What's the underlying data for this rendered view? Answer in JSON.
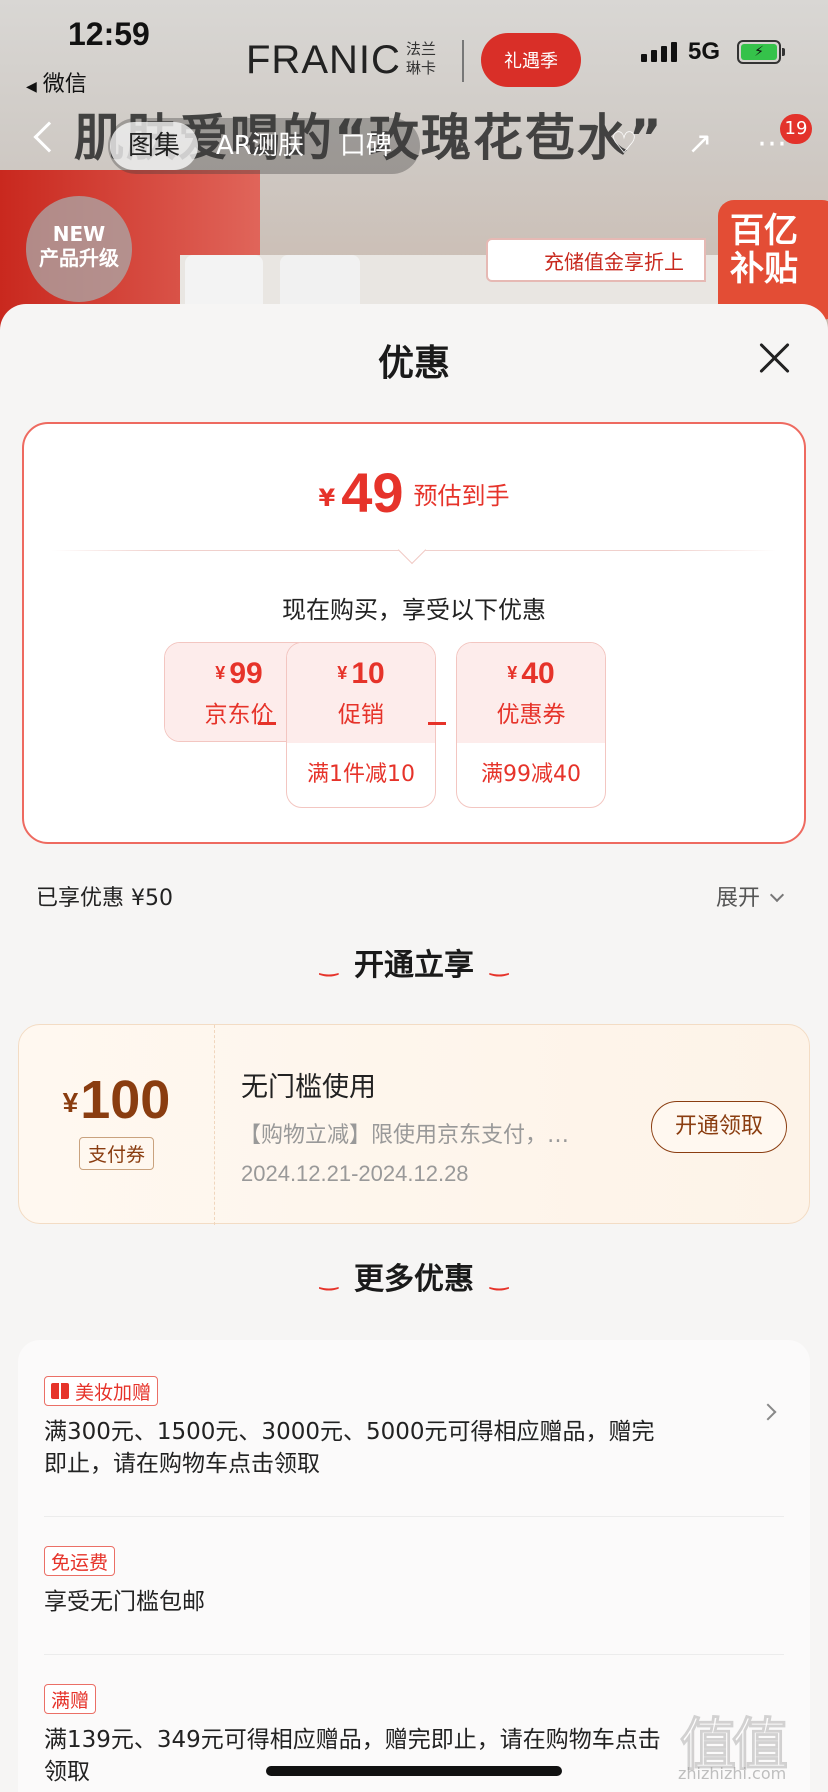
{
  "status": {
    "time": "12:59",
    "back_app": "微信",
    "network": "5G"
  },
  "background": {
    "brand": "FRANIC",
    "brand_cn_line1": "法兰",
    "brand_cn_line2": "琳卡",
    "brand_badge": "礼遇季",
    "headline": "肌肤爱喝的“玫瑰花苞水”",
    "tabs": [
      "图集",
      "AR测肤",
      "口碑"
    ],
    "active_tab": "图集",
    "cart_count": "19",
    "new_badge_line1": "NEW",
    "new_badge_line2": "产品升级",
    "promo_strip": "充储值金享折上",
    "subsidy_line1": "百亿",
    "subsidy_line2": "补贴"
  },
  "sheet": {
    "title": "优惠",
    "final": {
      "currency": "¥",
      "amount": "49",
      "label": "预估到手"
    },
    "explain": "现在购买，享受以下优惠",
    "terms": [
      {
        "currency": "¥",
        "amount": "99",
        "name": "京东价",
        "detail": ""
      },
      {
        "currency": "¥",
        "amount": "10",
        "name": "促销",
        "detail": "满1件减10"
      },
      {
        "currency": "¥",
        "amount": "40",
        "name": "优惠券",
        "detail": "满99减40"
      }
    ],
    "saved": "已享优惠 ¥50",
    "expand": "展开",
    "section_open": "开通立享",
    "vip": {
      "currency": "¥",
      "amount": "100",
      "tag": "支付券",
      "title": "无门槛使用",
      "desc": "【购物立减】限使用京东支付，…",
      "date": "2024.12.21-2024.12.28",
      "button": "开通领取"
    },
    "section_more": "更多优惠",
    "promos": [
      {
        "tag": "美妆加赠",
        "text": "满300元、1500元、3000元、5000元可得相应赠品，赠完即止，请在购物车点击领取"
      },
      {
        "tag": "免运费",
        "text": "享受无门槛包邮"
      },
      {
        "tag": "满赠",
        "text": "满139元、349元可得相应赠品，赠完即止，请在购物车点击领取"
      }
    ]
  },
  "watermark": {
    "main": "值",
    "sub": "zhizhizhi.com"
  },
  "colors": {
    "accent": "#e6332a",
    "vip": "#8a3d10",
    "sheet_bg": "#f6f5f4"
  }
}
